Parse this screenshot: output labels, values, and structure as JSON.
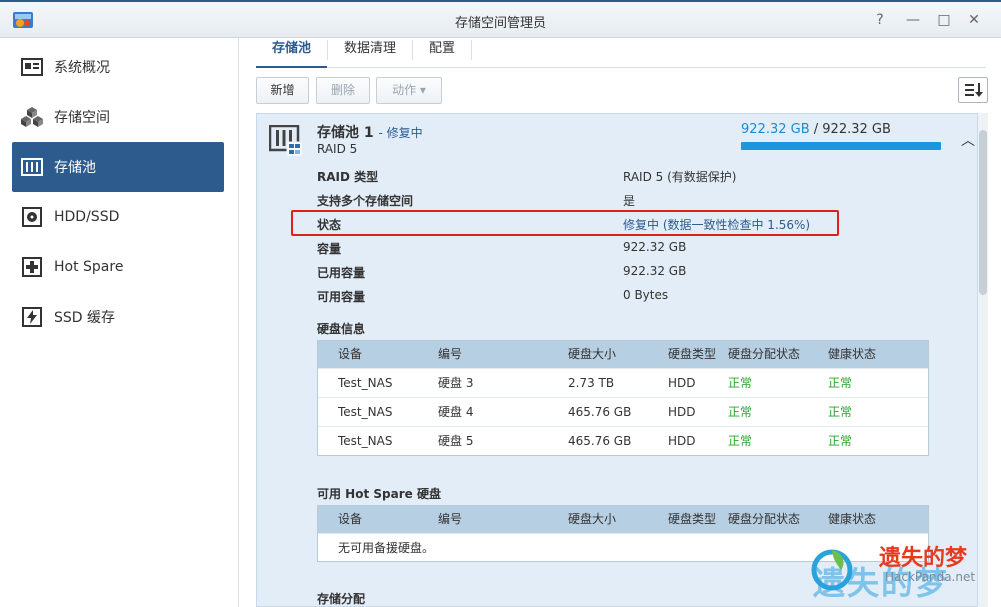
{
  "window": {
    "title": "存储空间管理员",
    "help": "?",
    "minimize": "—",
    "maximize": "□",
    "close": "✕"
  },
  "sidebar": {
    "items": [
      {
        "label": "系统概况",
        "icon": "overview-icon"
      },
      {
        "label": "存储空间",
        "icon": "cubes-icon"
      },
      {
        "label": "存储池",
        "icon": "storage-pool-icon",
        "active": true
      },
      {
        "label": "HDD/SSD",
        "icon": "disk-icon"
      },
      {
        "label": "Hot Spare",
        "icon": "plus-icon"
      },
      {
        "label": "SSD 缓存",
        "icon": "lightning-icon"
      }
    ]
  },
  "tabs": [
    "存储池",
    "数据清理",
    "配置"
  ],
  "toolbar": {
    "add": "新增",
    "delete": "删除",
    "action": "动作 ▾"
  },
  "pool": {
    "name": "存储池 1",
    "status_inline": "- 修复中",
    "raid": "RAID 5",
    "capacity_used": "922.32 GB",
    "capacity_sep": " / ",
    "capacity_total": "922.32 GB",
    "capacity_fill": 1.0,
    "collapse": "︿",
    "properties": [
      {
        "label": "RAID 类型",
        "value": "RAID 5 (有数据保护)"
      },
      {
        "label": "支持多个存储空间",
        "value": "是"
      },
      {
        "label": "状态",
        "value": "修复中 (数据一致性检查中 1.56%)"
      },
      {
        "label": "容量",
        "value": "922.32 GB"
      },
      {
        "label": "已用容量",
        "value": "922.32 GB"
      },
      {
        "label": "可用容量",
        "value": "0 Bytes"
      }
    ]
  },
  "disk_section": {
    "title": "硬盘信息",
    "headers": [
      "设备",
      "编号",
      "硬盘大小",
      "硬盘类型",
      "硬盘分配状态",
      "健康状态"
    ],
    "rows": [
      [
        "Test_NAS",
        "硬盘 3",
        "2.73 TB",
        "HDD",
        "正常",
        "正常"
      ],
      [
        "Test_NAS",
        "硬盘 4",
        "465.76 GB",
        "HDD",
        "正常",
        "正常"
      ],
      [
        "Test_NAS",
        "硬盘 5",
        "465.76 GB",
        "HDD",
        "正常",
        "正常"
      ]
    ]
  },
  "hotspare_section": {
    "title": "可用 Hot Spare 硬盘",
    "headers": [
      "设备",
      "编号",
      "硬盘大小",
      "硬盘类型",
      "硬盘分配状态",
      "健康状态"
    ],
    "empty": "无可用备援硬盘。"
  },
  "alloc_section": {
    "title": "存储分配"
  },
  "watermark": {
    "cn": "遗失的梦",
    "en": "HackPanda.net",
    "big": "遗失的梦"
  }
}
